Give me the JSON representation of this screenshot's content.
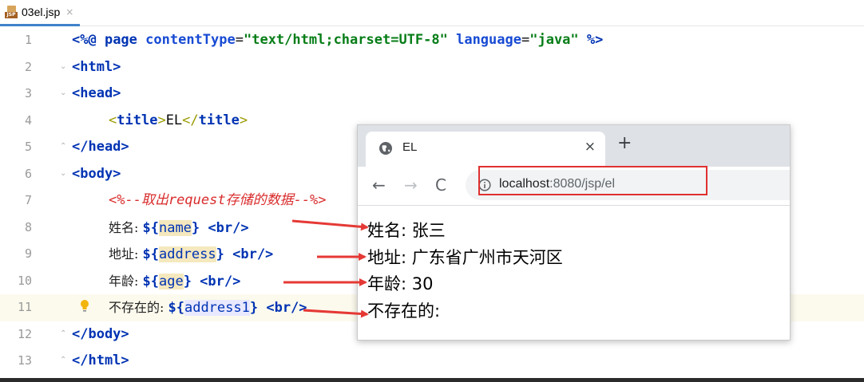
{
  "editor": {
    "tab": {
      "icon_label": "JSP",
      "file_name": "03el.jsp",
      "close": "×"
    },
    "lines": [
      {
        "no": "1"
      },
      {
        "no": "2"
      },
      {
        "no": "3"
      },
      {
        "no": "4"
      },
      {
        "no": "5"
      },
      {
        "no": "6"
      },
      {
        "no": "7"
      },
      {
        "no": "8"
      },
      {
        "no": "9"
      },
      {
        "no": "10"
      },
      {
        "no": "11"
      },
      {
        "no": "12"
      },
      {
        "no": "13"
      }
    ],
    "code": {
      "l1_open": "<%@ ",
      "l1_page": "page ",
      "l1_ct_attr": "contentType",
      "l1_eq1": "=",
      "l1_ct_val": "\"text/html;charset=UTF-8\"",
      "l1_lang_attr": " language",
      "l1_eq2": "=",
      "l1_lang_val": "\"java\"",
      "l1_close": " %>",
      "l2": "<html>",
      "l3": "<head>",
      "l4_open": "<",
      "l4_tag": "title",
      "l4_gt": ">",
      "l4_text": "EL",
      "l4_close_open": "</",
      "l4_close_tag": "title",
      "l4_close_gt": ">",
      "l5": "</head>",
      "l6": "<body>",
      "l7_comment": "<%--取出request存储的数据--%>",
      "l8_label": "姓名: ",
      "l8_el_open": "${",
      "l8_var": "name",
      "l8_el_close": "}",
      "l8_br": " <br/>",
      "l9_label": "地址: ",
      "l9_el_open": "${",
      "l9_var": "address",
      "l9_el_close": "}",
      "l9_br": " <br/>",
      "l10_label": "年龄: ",
      "l10_el_open": "${",
      "l10_var": "age",
      "l10_el_close": "}",
      "l10_br": " <br/>",
      "l11_label": "不存在的: ",
      "l11_el_open": "${",
      "l11_var": "address1",
      "l11_el_close": "}",
      "l11_br": " <br/>",
      "l12": "</body>",
      "l13": "</html>"
    }
  },
  "browser": {
    "tab_title": "EL",
    "tab_close": "×",
    "new_tab": "+",
    "back": "←",
    "forward": "→",
    "reload": "C",
    "url_host": "localhost",
    "url_rest": ":8080/jsp/el",
    "output": [
      "姓名: 张三",
      "地址: 广东省广州市天河区",
      "年龄: 30",
      "不存在的:"
    ]
  },
  "colors": {
    "annotation": "#e53935",
    "highlight_box": "#e03030"
  }
}
